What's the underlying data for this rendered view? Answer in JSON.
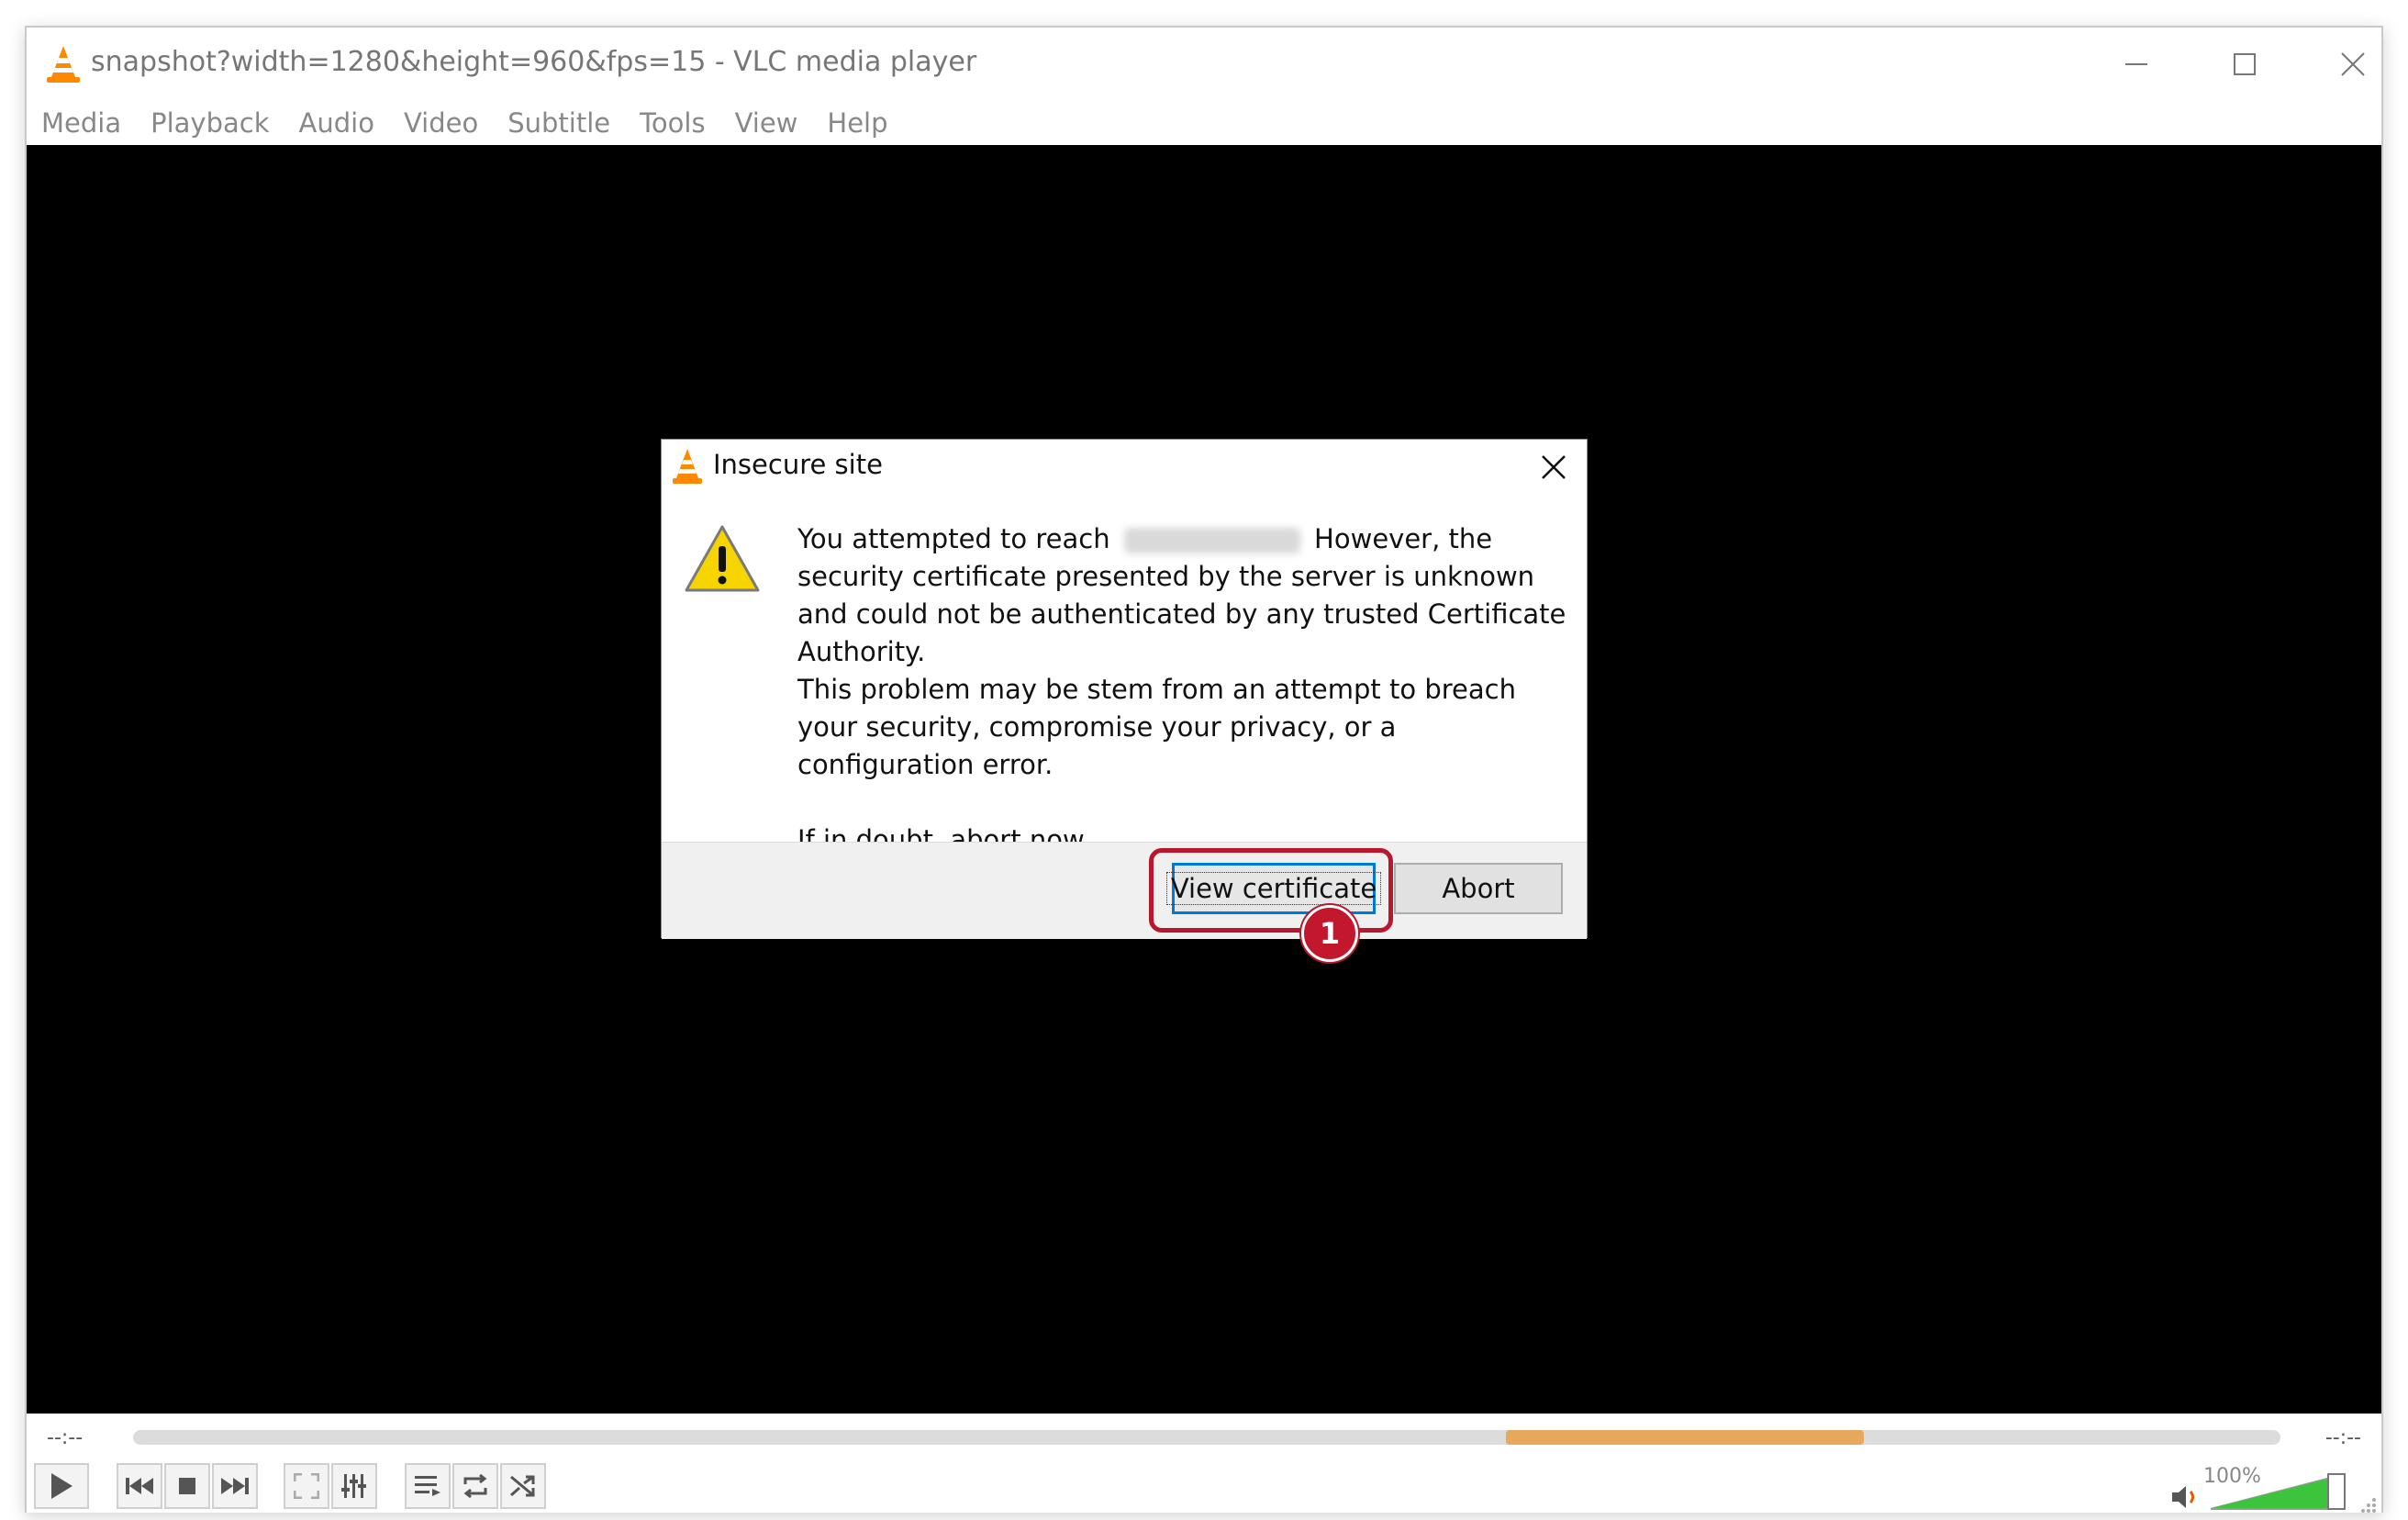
{
  "window": {
    "title": "snapshot?width=1280&height=960&fps=15 - VLC media player"
  },
  "menu": [
    "Media",
    "Playback",
    "Audio",
    "Video",
    "Subtitle",
    "Tools",
    "View",
    "Help"
  ],
  "controls": {
    "time_elapsed": "--:--",
    "time_total": "--:--",
    "volume_label": "100%",
    "volume_level": 1.0
  },
  "dialog": {
    "title": "Insecure site",
    "message_prefix": "You attempted to reach",
    "message_suffix": "However, the security certificate presented by the server is unknown and could not be authenticated by any trusted Certificate Authority.",
    "message_line2": "This problem may be stem from an attempt to breach your security, compromise your privacy, or a configuration error.",
    "message_line3": "If in doubt, abort now.",
    "view_certificate_label": "View certificate",
    "abort_label": "Abort"
  },
  "annotation": {
    "badge_number": "1",
    "color": "#b8172d"
  },
  "colors": {
    "vlc_orange": "#ff8800",
    "focus_blue": "#0078d7",
    "seek_buffer": "#e8a85c",
    "volume_green": "#3cc43c"
  },
  "icons": {
    "app": "vlc-cone-icon",
    "warning": "warning-triangle-icon",
    "close": "close-icon"
  }
}
